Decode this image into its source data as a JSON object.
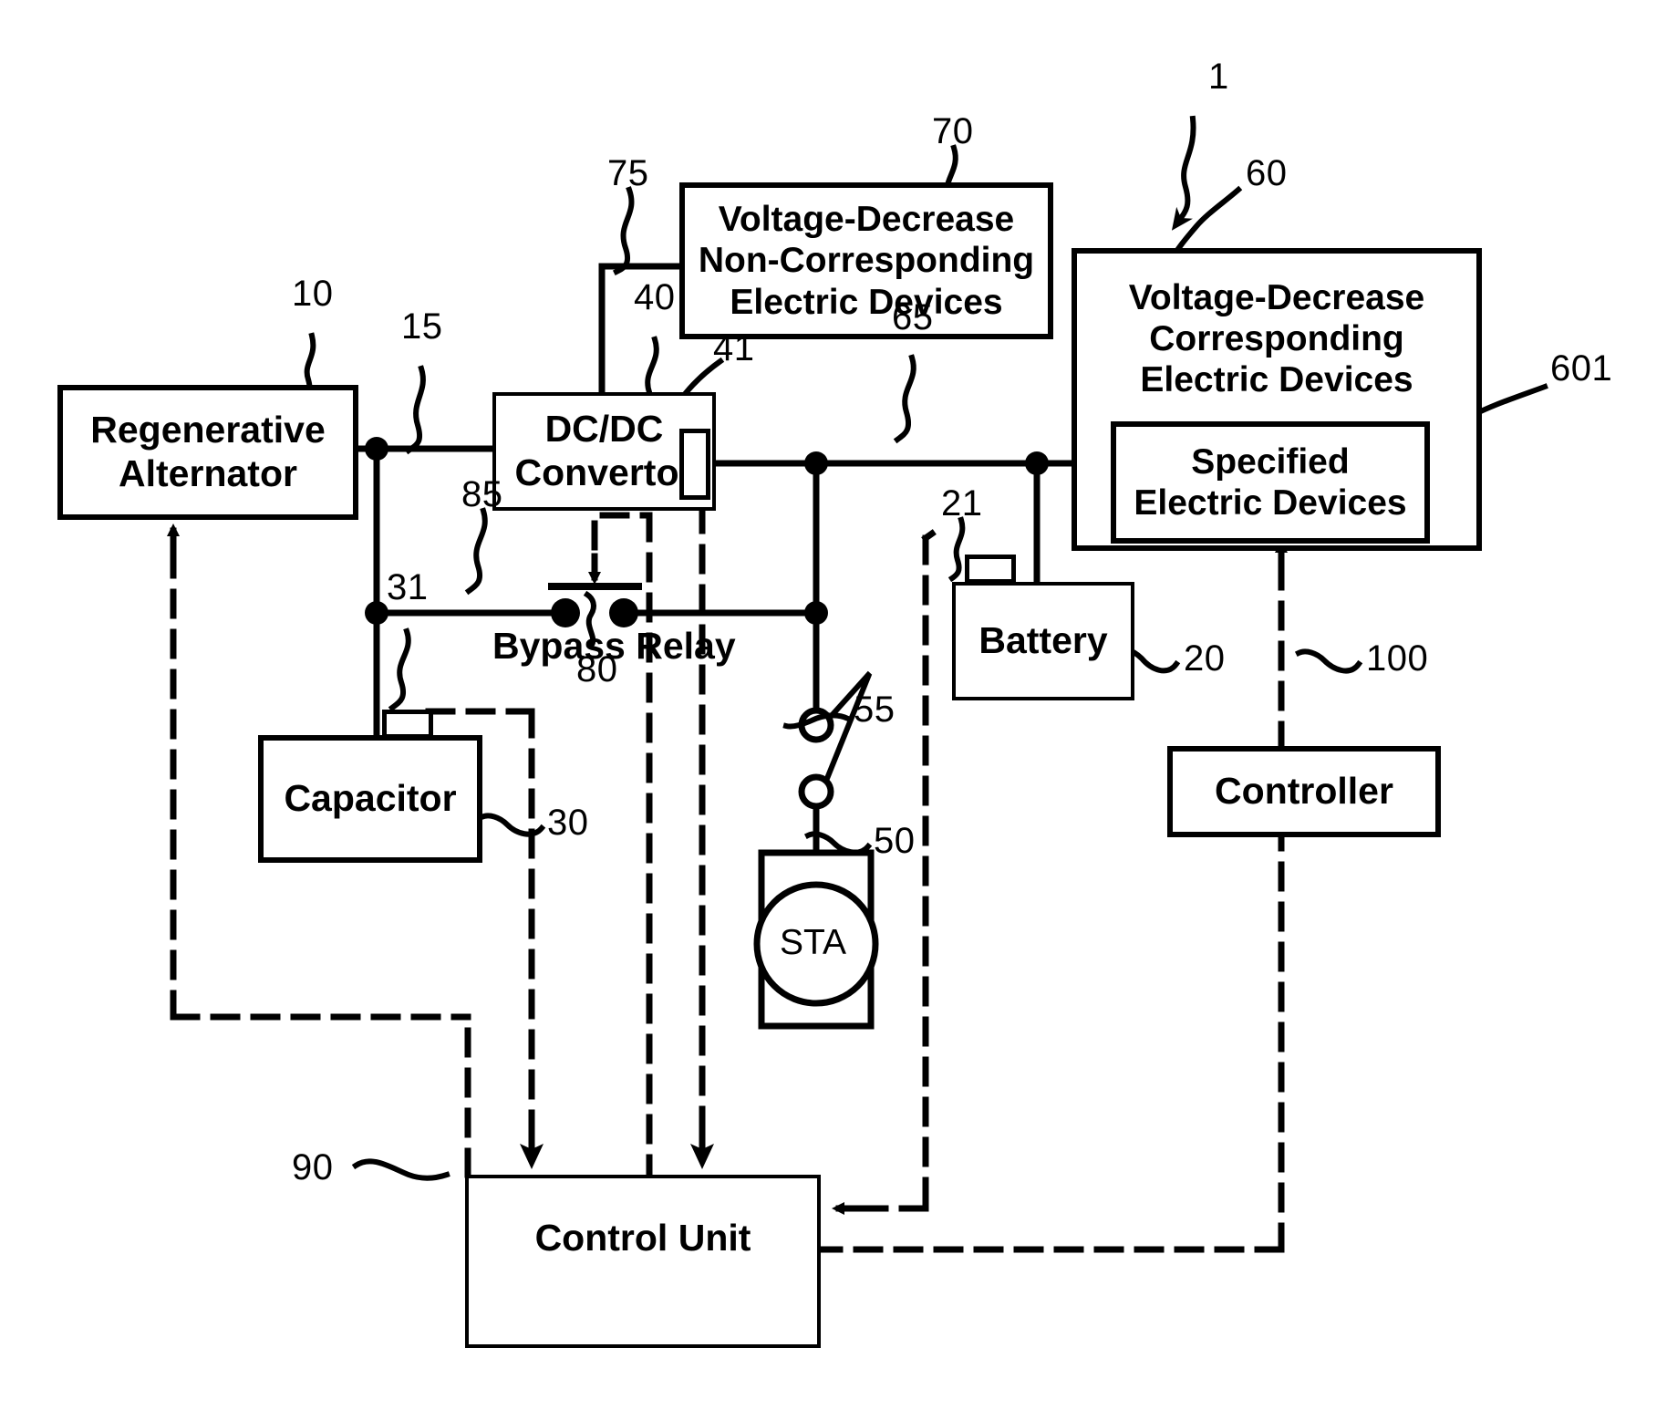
{
  "figure": {
    "system_ref": "1",
    "blocks": {
      "regenerative_alternator": {
        "ref": "10",
        "lines": [
          "Regenerative",
          "Alternator"
        ]
      },
      "dcdc_convertor": {
        "ref": "40",
        "lines": [
          "DC/DC",
          "Convertor"
        ],
        "terminal_ref": "41"
      },
      "voltage_decrease_non_corresponding": {
        "ref": "70",
        "lines": [
          "Voltage-Decrease",
          "Non-Corresponding",
          "Electric Devices"
        ]
      },
      "voltage_decrease_corresponding": {
        "ref": "60",
        "lines": [
          "Voltage-Decrease",
          "Corresponding",
          "Electric Devices"
        ]
      },
      "specified_electric_devices": {
        "ref": "601",
        "lines": [
          "Specified",
          "Electric Devices"
        ]
      },
      "battery": {
        "ref": "20",
        "lines": [
          "Battery"
        ],
        "terminal_ref": "21"
      },
      "capacitor": {
        "ref": "30",
        "lines": [
          "Capacitor"
        ],
        "terminal_ref": "31"
      },
      "controller": {
        "ref": "100",
        "lines": [
          "Controller"
        ]
      },
      "control_unit": {
        "ref": "90",
        "lines": [
          "Control Unit"
        ]
      },
      "starter": {
        "ref": "50",
        "lines": [
          "STA"
        ]
      },
      "bypass_relay": {
        "ref": "80",
        "lines": [
          "Bypass Relay"
        ]
      }
    },
    "line_refs": {
      "alternator_to_dcdc": "15",
      "dcdc_to_non_corresponding": "75",
      "dcdc_output_bus": "65",
      "bypass_line": "85",
      "starter_switch": "55"
    },
    "ref_labels": [
      {
        "id": "ref-1",
        "text": "1"
      },
      {
        "id": "ref-10",
        "text": "10"
      },
      {
        "id": "ref-15",
        "text": "15"
      },
      {
        "id": "ref-20",
        "text": "20"
      },
      {
        "id": "ref-21",
        "text": "21"
      },
      {
        "id": "ref-30",
        "text": "30"
      },
      {
        "id": "ref-31",
        "text": "31"
      },
      {
        "id": "ref-40",
        "text": "40"
      },
      {
        "id": "ref-41",
        "text": "41"
      },
      {
        "id": "ref-50",
        "text": "50"
      },
      {
        "id": "ref-55",
        "text": "55"
      },
      {
        "id": "ref-60",
        "text": "60"
      },
      {
        "id": "ref-601",
        "text": "601"
      },
      {
        "id": "ref-65",
        "text": "65"
      },
      {
        "id": "ref-70",
        "text": "70"
      },
      {
        "id": "ref-75",
        "text": "75"
      },
      {
        "id": "ref-80",
        "text": "80"
      },
      {
        "id": "ref-85",
        "text": "85"
      },
      {
        "id": "ref-90",
        "text": "90"
      },
      {
        "id": "ref-100",
        "text": "100"
      }
    ],
    "colors": {
      "ink": "#000000",
      "paper": "#ffffff"
    }
  }
}
